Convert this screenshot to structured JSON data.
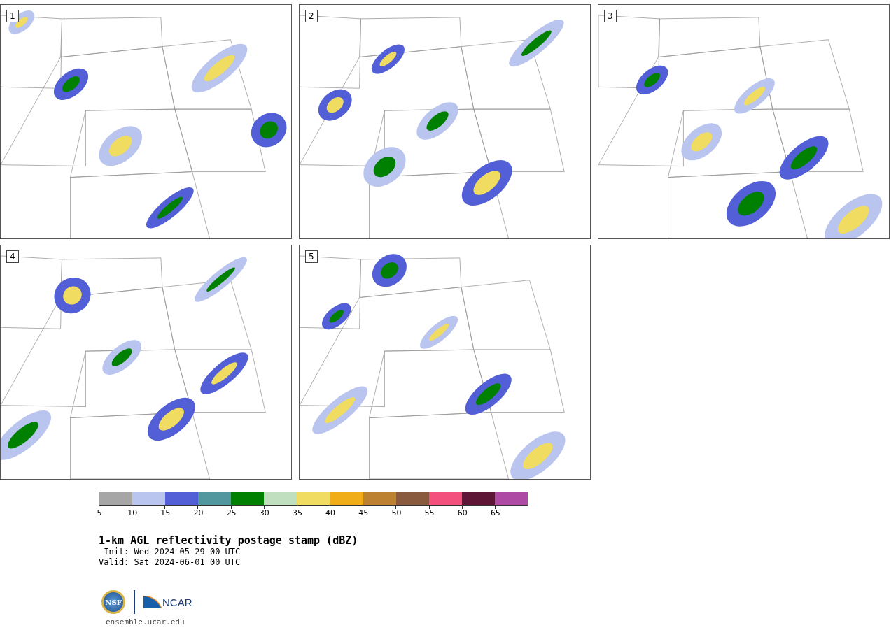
{
  "panels": [
    {
      "label": "1"
    },
    {
      "label": "2"
    },
    {
      "label": "3"
    },
    {
      "label": "4"
    },
    {
      "label": "5"
    }
  ],
  "colorbar": {
    "bins": [
      {
        "color": "#a6a6a6",
        "tick": "5"
      },
      {
        "color": "#b9c5ee",
        "tick": "10"
      },
      {
        "color": "#525fd6",
        "tick": "15"
      },
      {
        "color": "#52979e",
        "tick": "20"
      },
      {
        "color": "#008000",
        "tick": "25"
      },
      {
        "color": "#bfdfbf",
        "tick": "30"
      },
      {
        "color": "#f0dc60",
        "tick": "35"
      },
      {
        "color": "#f0ad18",
        "tick": "40"
      },
      {
        "color": "#bc8232",
        "tick": "45"
      },
      {
        "color": "#8a5a3e",
        "tick": "50"
      },
      {
        "color": "#f4507e",
        "tick": "55"
      },
      {
        "color": "#5e1636",
        "tick": "60"
      },
      {
        "color": "#ae4aa4",
        "tick": "65"
      }
    ]
  },
  "title": "1-km AGL reflectivity postage stamp (dBZ)",
  "init": " Init: Wed 2024-05-29 00 UTC",
  "valid": "Valid: Sat 2024-06-01 00 UTC",
  "logos": {
    "nsf": "NSF",
    "ncar": "NCAR"
  },
  "url": "ensemble.ucar.edu"
}
